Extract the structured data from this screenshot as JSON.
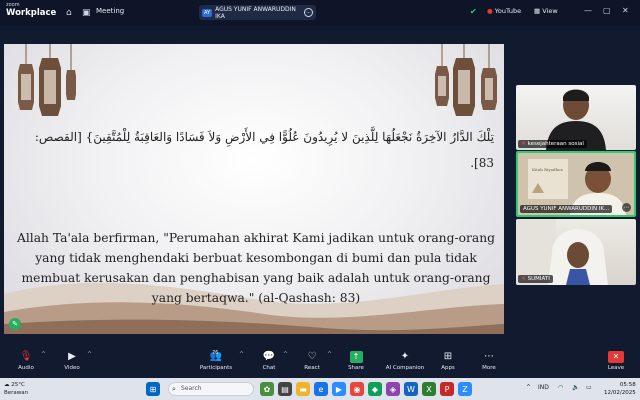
{
  "topbar": {
    "logo_line1": "zoom",
    "logo_line2": "Workplace",
    "meeting_label": "Meeting",
    "meeting_badge": "AY",
    "meeting_name": "AGUS YUNIF ANWARUDDIN IKA",
    "stream_label": "YouTube",
    "view_label": "View"
  },
  "slide": {
    "arabic": "تِلْكَ الدَّارُ الآخِرَةُ نَجْعَلُهَا لِلَّذِينَ لا يُرِيدُونَ عُلُوًّا فِي الأَرْضِ وَلاَ فَسَادًا وَالعَاقِبَةُ لِلْمُتَّقِينَ} [القصص: 83].",
    "translation": "Allah Ta'ala berfirman, \"Perumahan akhirat Kami jadikan untuk orang-orang yang tidak menghendaki berbuat kesombongan di bumi dan pula tidak membuat kerusakan dan penghabisan yang baik adalah untuk orang-orang yang bertaqwa.\" (al-Qashash: 83)"
  },
  "participants": [
    {
      "name": "kesejahteraan sosial"
    },
    {
      "name": "AGUS YUNIF ANWARUDDIN IK..."
    },
    {
      "name": "SUMIATI"
    }
  ],
  "toolbar": {
    "audio": "Audio",
    "video": "Video",
    "participants": "Participants",
    "participant_count": "76",
    "chat": "Chat",
    "react": "React",
    "share": "Share",
    "companion": "AI Companion",
    "apps": "Apps",
    "more": "More",
    "leave": "Leave"
  },
  "taskbar": {
    "temperature": "25°C",
    "weather": "Berawan",
    "search_placeholder": "Search",
    "lang": "IND",
    "time": "05:58",
    "date": "12/02/2025"
  },
  "colors": {
    "accent_green": "#2ecc71",
    "leave_red": "#e53935",
    "lantern_brown": "#7a5a46"
  }
}
